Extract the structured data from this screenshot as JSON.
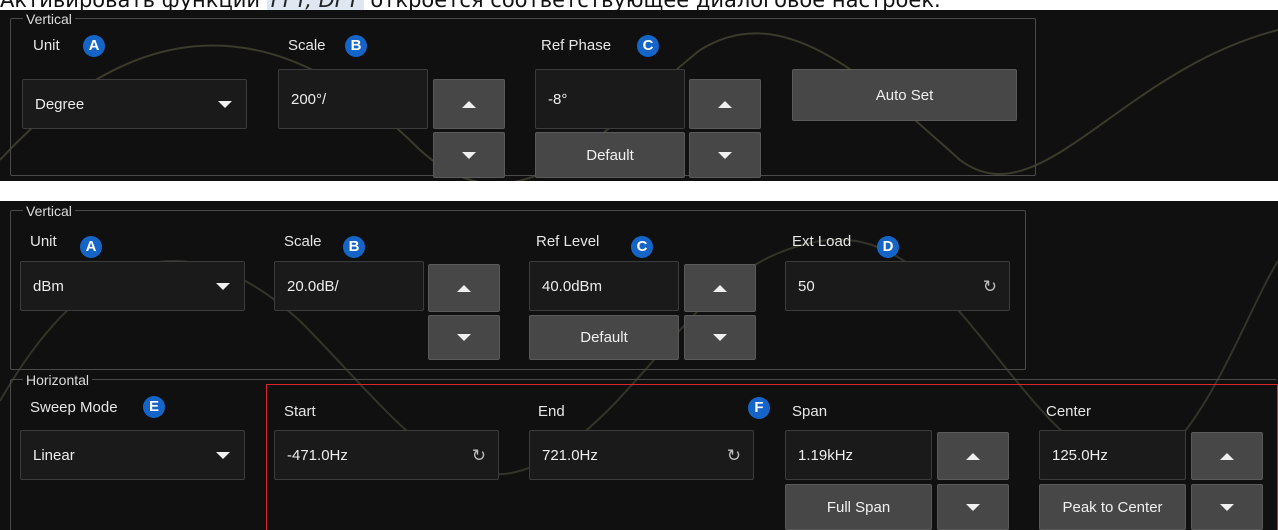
{
  "caption": {
    "prefix": "Активировать функции ",
    "highlight": "FFT, DFT",
    "suffix": " откроется соответствующее диалоговое настроек."
  },
  "panel1": {
    "vertical": {
      "title": "Vertical",
      "unit": {
        "label": "Unit",
        "badge": "A",
        "value": "Degree"
      },
      "scale": {
        "label": "Scale",
        "badge": "B",
        "value": "200°/"
      },
      "ref_phase": {
        "label": "Ref Phase",
        "badge": "C",
        "value": "-8°",
        "default_label": "Default"
      },
      "auto_set_label": "Auto Set"
    }
  },
  "panel2": {
    "vertical": {
      "title": "Vertical",
      "unit": {
        "label": "Unit",
        "badge": "A",
        "value": "dBm"
      },
      "scale": {
        "label": "Scale",
        "badge": "B",
        "value": "20.0dB/"
      },
      "ref_level": {
        "label": "Ref Level",
        "badge": "C",
        "value": "40.0dBm",
        "default_label": "Default"
      },
      "ext_load": {
        "label": "Ext Load",
        "badge": "D",
        "value": "50"
      }
    },
    "horizontal": {
      "title": "Horizontal",
      "sweep_mode": {
        "label": "Sweep Mode",
        "badge": "E",
        "value": "Linear"
      },
      "badge_f": "F",
      "start": {
        "label": "Start",
        "value": "-471.0Hz"
      },
      "end": {
        "label": "End",
        "value": "721.0Hz"
      },
      "span": {
        "label": "Span",
        "value": "1.19kHz",
        "full_span_label": "Full Span"
      },
      "center": {
        "label": "Center",
        "value": "125.0Hz",
        "peak_label": "Peak to Center"
      }
    }
  },
  "icons": [
    "dropdown-arrow-icon",
    "arrow-up-icon",
    "arrow-down-icon",
    "refresh-icon"
  ],
  "colors": {
    "background": "#101010",
    "badge": "#1565c8",
    "highlight_border": "#d9262b",
    "button": "#474747"
  }
}
